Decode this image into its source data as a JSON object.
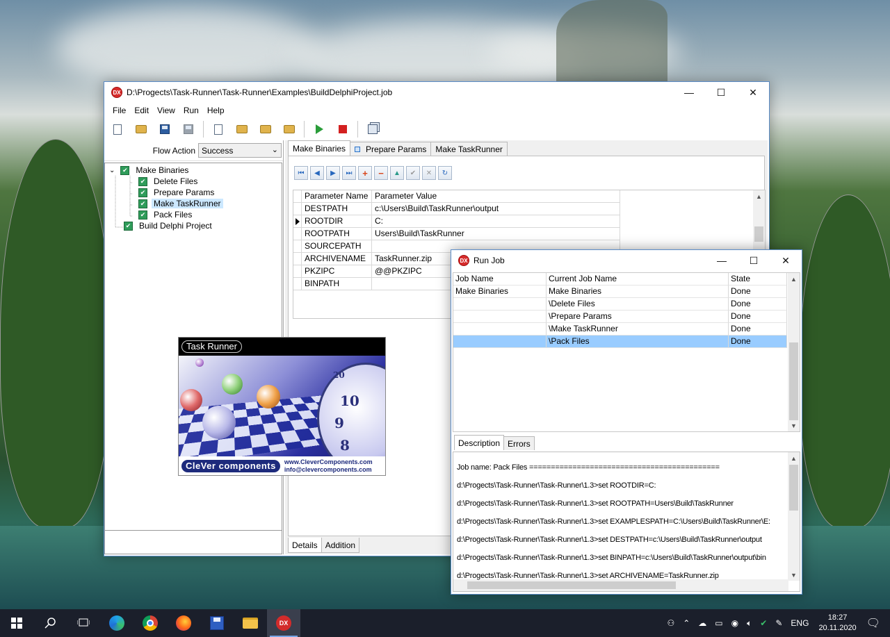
{
  "main_window": {
    "title": "D:\\Progects\\Task-Runner\\Task-Runner\\Examples\\BuildDelphiProject.job",
    "app_icon_text": "DX",
    "controls": {
      "minimize": "—",
      "maximize": "☐",
      "close": "✕"
    },
    "menu": [
      "File",
      "Edit",
      "View",
      "Run",
      "Help"
    ],
    "toolbar_icons": [
      "new-icon",
      "open-icon",
      "save-icon",
      "save-disabled-icon",
      "new-job-icon",
      "open-job-icon",
      "export-icon",
      "import-icon",
      "run-icon",
      "stop-icon",
      "copy-icon"
    ],
    "flow_action": {
      "label": "Flow Action",
      "value": "Success"
    },
    "tree": [
      {
        "label": "Make Binaries",
        "level": 0
      },
      {
        "label": "Delete Files",
        "level": 1
      },
      {
        "label": "Prepare Params",
        "level": 1
      },
      {
        "label": "Make TaskRunner",
        "level": 1,
        "selected": true
      },
      {
        "label": "Pack Files",
        "level": 1
      },
      {
        "label": "Build Delphi Project",
        "level": 0
      }
    ],
    "tabs": [
      "Make Binaries",
      "Prepare Params",
      "Make TaskRunner"
    ],
    "active_tab": "Make Binaries",
    "nav_buttons": [
      "first",
      "prior",
      "next",
      "last",
      "insert",
      "delete",
      "edit",
      "post",
      "cancel",
      "refresh"
    ],
    "params_grid": {
      "columns": [
        "Parameter Name",
        "Parameter Value"
      ],
      "rows": [
        [
          "DESTPATH",
          "c:\\Users\\Build\\TaskRunner\\output"
        ],
        [
          "ROOTDIR",
          "C:"
        ],
        [
          "ROOTPATH",
          "Users\\Build\\TaskRunner"
        ],
        [
          "SOURCEPATH",
          ""
        ],
        [
          "ARCHIVENAME",
          "TaskRunner.zip"
        ],
        [
          "PKZIPC",
          "@@PKZIPC"
        ],
        [
          "BINPATH",
          ""
        ]
      ],
      "current_row": 1
    },
    "bottom_tabs": [
      "Details",
      "Addition"
    ]
  },
  "splash": {
    "product": "Task Runner",
    "vendor": "CleVer components",
    "links": [
      "www.CleverComponents.com",
      "info@clevercomponents.com"
    ],
    "clock_numbers": [
      "20",
      "10",
      "9",
      "8"
    ]
  },
  "run_job": {
    "title": "Run Job",
    "app_icon_text": "DX",
    "columns": [
      "Job Name",
      "Current Job Name",
      "State"
    ],
    "rows": [
      [
        "Make Binaries",
        "Make Binaries",
        "Done"
      ],
      [
        "",
        "\\Delete Files",
        "Done"
      ],
      [
        "",
        "\\Prepare Params",
        "Done"
      ],
      [
        "",
        "\\Make TaskRunner",
        "Done"
      ],
      [
        "",
        "\\Pack Files",
        "Done"
      ]
    ],
    "selected_row": 4,
    "tabs": [
      "Description",
      "Errors"
    ],
    "description_lines": [
      "Job name: Pack Files ============================================",
      "d:\\Progects\\Task-Runner\\Task-Runner\\1.3>set ROOTDIR=C:",
      "d:\\Progects\\Task-Runner\\Task-Runner\\1.3>set ROOTPATH=Users\\Build\\TaskRunner",
      "d:\\Progects\\Task-Runner\\Task-Runner\\1.3>set EXAMPLESPATH=C:\\Users\\Build\\TaskRunner\\E:",
      "d:\\Progects\\Task-Runner\\Task-Runner\\1.3>set DESTPATH=c:\\Users\\Build\\TaskRunner\\output",
      "d:\\Progects\\Task-Runner\\Task-Runner\\1.3>set BINPATH=c:\\Users\\Build\\TaskRunner\\output\\bin",
      "d:\\Progects\\Task-Runner\\Task-Runner\\1.3>set ARCHIVENAME=TaskRunner.zip"
    ]
  },
  "taskbar": {
    "apps": [
      "start",
      "search",
      "task-view",
      "edge",
      "chrome",
      "firefox",
      "save-app",
      "file-explorer",
      "dx-app"
    ],
    "tray": {
      "language": "ENG",
      "time": "18:27",
      "date": "20.11.2020"
    }
  }
}
